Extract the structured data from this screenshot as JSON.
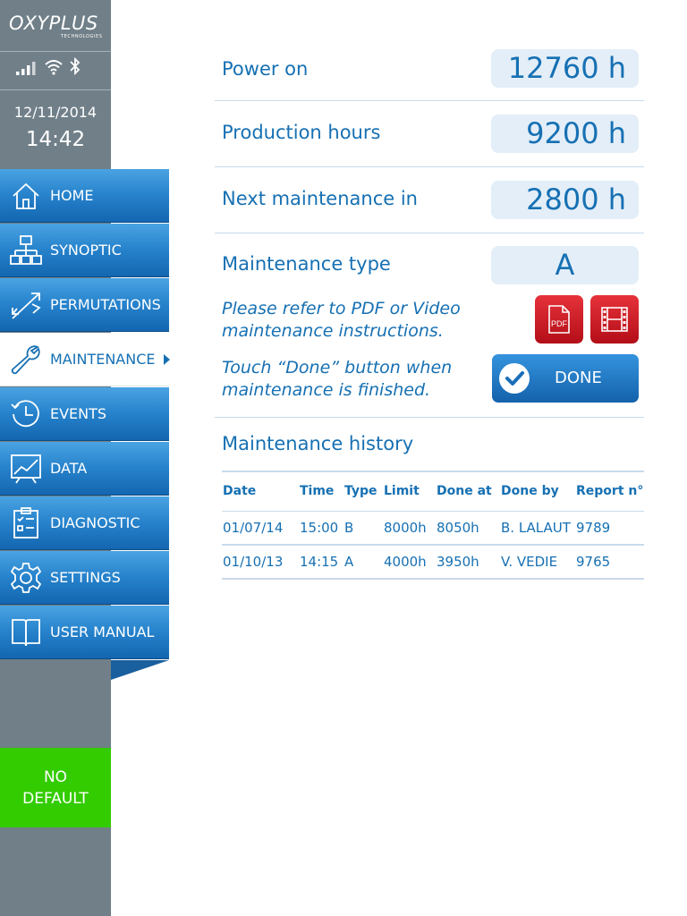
{
  "brand": {
    "name": "OXYPLUS",
    "sub": "TECHNOLOGIES"
  },
  "status_bar": {
    "icons": [
      "signal-icon",
      "wifi-icon",
      "bluetooth-icon"
    ]
  },
  "clock": {
    "date": "12/11/2014",
    "time": "14:42"
  },
  "nav": {
    "items": [
      {
        "label": "HOME",
        "icon": "home-icon"
      },
      {
        "label": "SYNOPTIC",
        "icon": "synoptic-icon"
      },
      {
        "label": "PERMUTATIONS",
        "icon": "permutations-icon"
      },
      {
        "label": "MAINTENANCE",
        "icon": "wrench-icon",
        "active": true
      },
      {
        "label": "EVENTS",
        "icon": "clock-icon"
      },
      {
        "label": "DATA",
        "icon": "chart-icon"
      },
      {
        "label": "DIAGNOSTIC",
        "icon": "checklist-icon"
      },
      {
        "label": "SETTINGS",
        "icon": "gear-icon"
      },
      {
        "label": "USER MANUAL",
        "icon": "book-icon"
      }
    ]
  },
  "status_box": {
    "line1": "NO",
    "line2": "DEFAULT"
  },
  "info": {
    "power_on": {
      "label": "Power on",
      "value": "12760 h"
    },
    "production_hours": {
      "label": "Production hours",
      "value": "9200 h"
    },
    "next_maintenance": {
      "label": "Next maintenance in",
      "value": "2800 h"
    },
    "maintenance_type": {
      "label": "Maintenance type",
      "value": "A"
    }
  },
  "instructions": {
    "refer_note": "Please refer to PDF or Video\nmaintenance instructions.",
    "done_note": "Touch “Done” button when\nmaintenance is finished.",
    "pdf_label": "PDF"
  },
  "done_button": {
    "label": "DONE"
  },
  "history": {
    "title": "Maintenance history",
    "columns": [
      "Date",
      "Time",
      "Type",
      "Limit",
      "Done at",
      "Done by",
      "Report n°"
    ],
    "rows": [
      [
        "01/07/14",
        "15:00",
        "B",
        "8000h",
        "8050h",
        "B. LALAUT",
        "9789"
      ],
      [
        "01/10/13",
        "14:15",
        "A",
        "4000h",
        "3950h",
        "V. VEDIE",
        "9765"
      ]
    ]
  },
  "colors": {
    "accent": "#1670b3",
    "sidebar": "#707f88",
    "nav_gradient_top": "#4aa3e2",
    "nav_gradient_bottom": "#1466b0",
    "value_box": "#e3eef8",
    "status_ok": "#33cc00",
    "media_button": "#c8141e"
  }
}
